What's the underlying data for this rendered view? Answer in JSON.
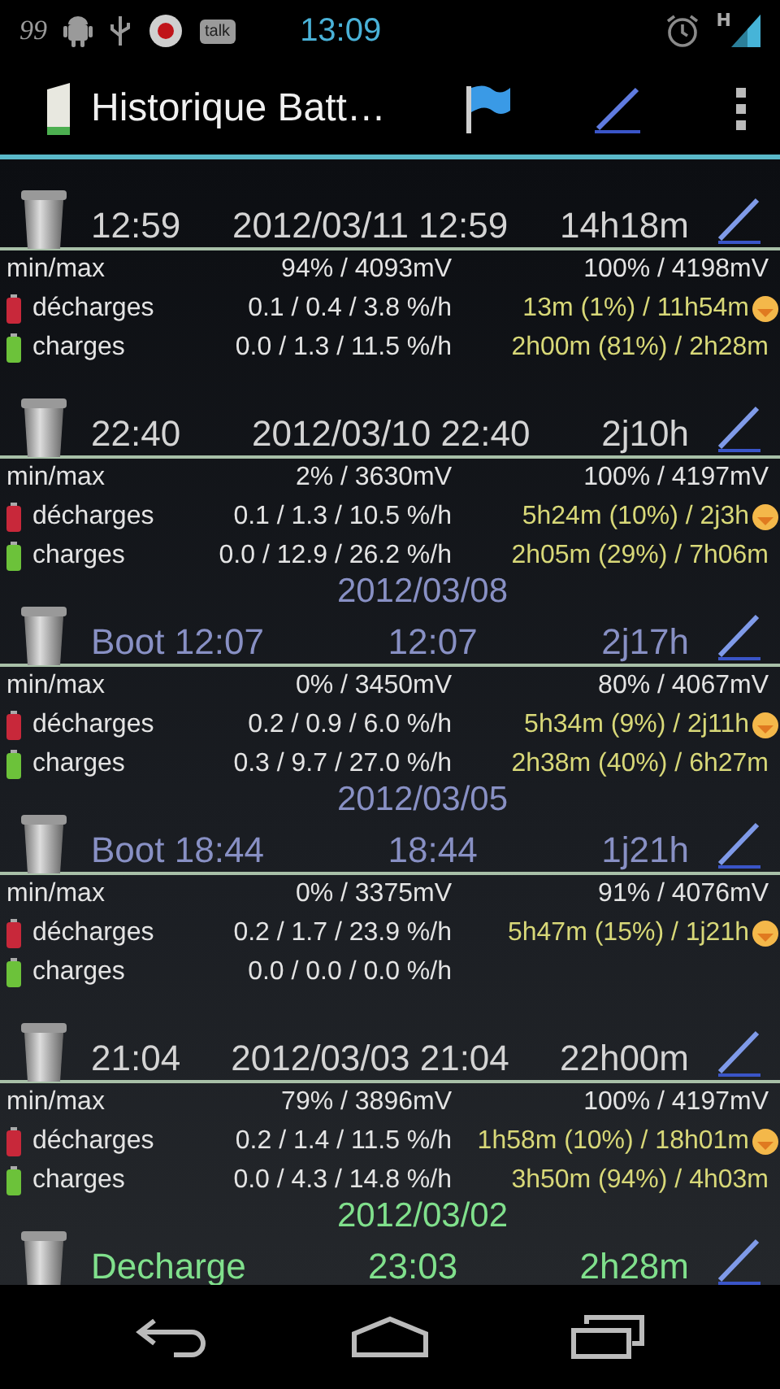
{
  "status_bar": {
    "notification_text": "99",
    "talk_label": "talk",
    "time": "13:09",
    "network": "H"
  },
  "action_bar": {
    "title": "Historique Batt…"
  },
  "entries": [
    {
      "kind": "normal",
      "label": "12:59",
      "middle": "2012/03/11 12:59",
      "duration": "14h18m",
      "details": {
        "minmax_label": "min/max",
        "min": "94% / 4093mV",
        "max": "100% / 4198mV",
        "discharge_label": "décharges",
        "discharge_rates": "0.1 / 0.4 / 3.8 %/h",
        "discharge_estimate": "13m (1%) / 11h54m",
        "charge_label": "charges",
        "charge_rates": "0.0 / 1.3 / 11.5 %/h",
        "charge_estimate": "2h00m (81%) / 2h28m"
      }
    },
    {
      "kind": "normal",
      "label": "22:40",
      "middle": "2012/03/10 22:40",
      "duration": "2j10h",
      "details": {
        "minmax_label": "min/max",
        "min": "2% / 3630mV",
        "max": "100% / 4197mV",
        "discharge_label": "décharges",
        "discharge_rates": "0.1 / 1.3 / 10.5 %/h",
        "discharge_estimate": "5h24m (10%) / 2j3h",
        "charge_label": "charges",
        "charge_rates": "0.0 / 12.9 / 26.2 %/h",
        "charge_estimate": "2h05m (29%) / 7h06m"
      }
    },
    {
      "kind": "boot",
      "date": "2012/03/08",
      "label": "Boot 12:07",
      "middle": "12:07",
      "duration": "2j17h",
      "details": {
        "minmax_label": "min/max",
        "min": "0% / 3450mV",
        "max": "80% / 4067mV",
        "discharge_label": "décharges",
        "discharge_rates": "0.2 / 0.9 / 6.0 %/h",
        "discharge_estimate": "5h34m (9%) / 2j11h",
        "charge_label": "charges",
        "charge_rates": "0.3 / 9.7 / 27.0 %/h",
        "charge_estimate": "2h38m (40%) / 6h27m"
      }
    },
    {
      "kind": "boot",
      "date": "2012/03/05",
      "label": "Boot 18:44",
      "middle": "18:44",
      "duration": "1j21h",
      "details": {
        "minmax_label": "min/max",
        "min": "0% / 3375mV",
        "max": "91% / 4076mV",
        "discharge_label": "décharges",
        "discharge_rates": "0.2 / 1.7 / 23.9 %/h",
        "discharge_estimate": "5h47m (15%) / 1j21h",
        "charge_label": "charges",
        "charge_rates": "0.0 / 0.0 / 0.0 %/h"
      }
    },
    {
      "kind": "normal",
      "label": "21:04",
      "middle": "2012/03/03 21:04",
      "duration": "22h00m",
      "details": {
        "minmax_label": "min/max",
        "min": "79% / 3896mV",
        "max": "100% / 4197mV",
        "discharge_label": "décharges",
        "discharge_rates": "0.2 / 1.4 / 11.5 %/h",
        "discharge_estimate": "1h58m (10%) / 18h01m",
        "charge_label": "charges",
        "charge_rates": "0.0 / 4.3 / 14.8 %/h",
        "charge_estimate": "3h50m (94%) / 4h03m"
      }
    },
    {
      "kind": "decharge",
      "date": "2012/03/02",
      "label": "Decharge",
      "middle": "23:03",
      "duration": "2h28m"
    }
  ]
}
